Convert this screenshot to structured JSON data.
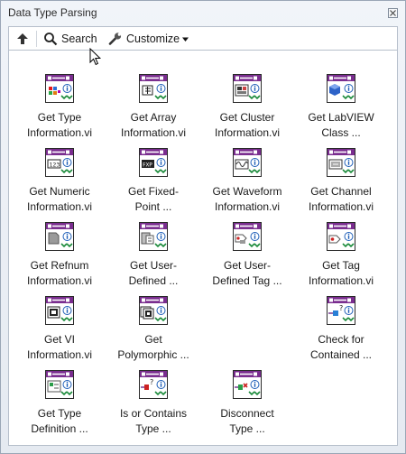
{
  "window": {
    "title": "Data Type Parsing"
  },
  "toolbar": {
    "search_label": "Search",
    "customize_label": "Customize"
  },
  "colors": {
    "accent": "#6a2b8c",
    "palette_bg": "#ffffff"
  },
  "items": [
    {
      "label": "Get Type\nInformation.vi",
      "icon": "type-info-icon"
    },
    {
      "label": "Get Array\nInformation.vi",
      "icon": "array-info-icon"
    },
    {
      "label": "Get Cluster\nInformation.vi",
      "icon": "cluster-info-icon"
    },
    {
      "label": "Get LabVIEW\nClass ...",
      "icon": "class-info-icon"
    },
    {
      "label": "Get Numeric\nInformation.vi",
      "icon": "numeric-info-icon"
    },
    {
      "label": "Get Fixed-\nPoint ...",
      "icon": "fixed-point-info-icon"
    },
    {
      "label": "Get Waveform\nInformation.vi",
      "icon": "waveform-info-icon"
    },
    {
      "label": "Get Channel\nInformation.vi",
      "icon": "channel-info-icon"
    },
    {
      "label": "Get Refnum\nInformation.vi",
      "icon": "refnum-info-icon"
    },
    {
      "label": "Get User-\nDefined ...",
      "icon": "user-defined-info-icon"
    },
    {
      "label": "Get User-\nDefined Tag ...",
      "icon": "user-tag-info-icon"
    },
    {
      "label": "Get Tag\nInformation.vi",
      "icon": "tag-info-icon"
    },
    {
      "label": "Get VI\nInformation.vi",
      "icon": "vi-info-icon"
    },
    {
      "label": "Get\nPolymorphic ...",
      "icon": "polymorphic-info-icon"
    },
    {
      "label": "",
      "icon": ""
    },
    {
      "label": "Check for\nContained ...",
      "icon": "check-contained-icon"
    },
    {
      "label": "Get Type\nDefinition ...",
      "icon": "type-definition-icon"
    },
    {
      "label": "Is or Contains\nType ...",
      "icon": "is-contains-type-icon"
    },
    {
      "label": "Disconnect\nType ...",
      "icon": "disconnect-type-icon"
    }
  ]
}
